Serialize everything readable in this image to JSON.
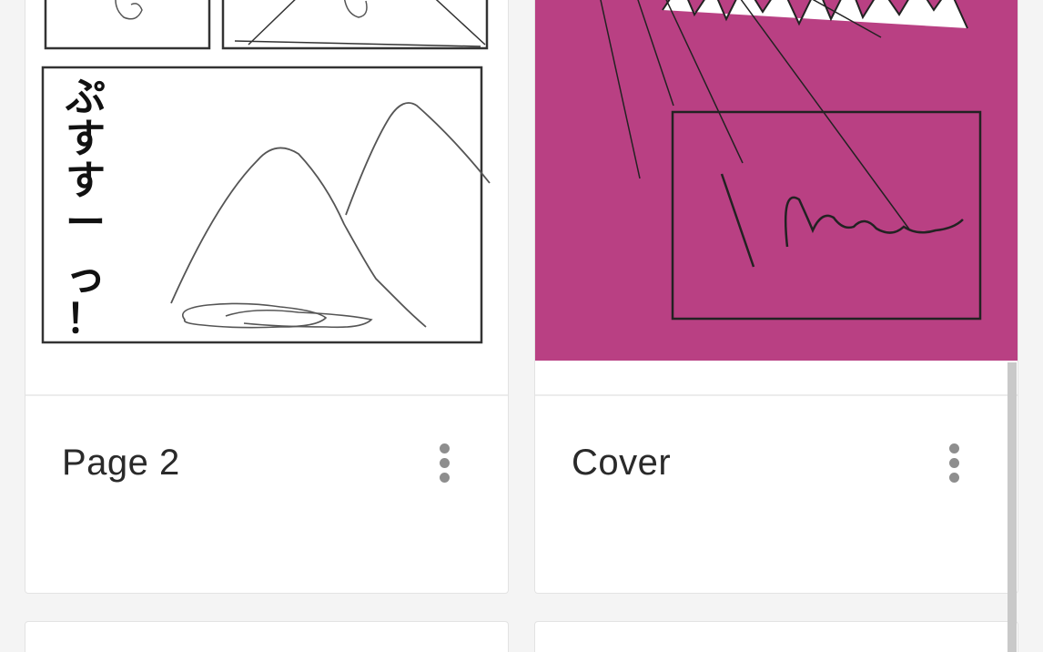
{
  "pages": [
    {
      "title": "Page 2",
      "sfx_text": "ぷすすーっ！",
      "thumbnail_background": "#ffffff"
    },
    {
      "title": "Cover",
      "thumbnail_background": "#b94083"
    }
  ],
  "icons": {
    "more": "more-vertical-icon"
  },
  "colors": {
    "card_background": "#ffffff",
    "page_background": "#f4f4f4",
    "ink": "#2a2a2a",
    "menu_dots": "#8e8e8e",
    "cover_magenta": "#b94083"
  }
}
